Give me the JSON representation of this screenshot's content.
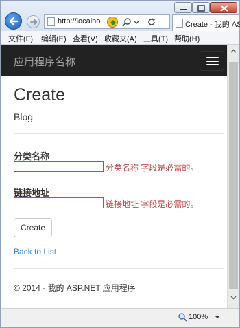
{
  "browser": {
    "address": "http://localho",
    "tab_title": "Create - 我的 ASP",
    "menu": [
      "文件(F)",
      "编辑(E)",
      "查看(V)",
      "收藏夹(A)",
      "工具(T)",
      "帮助(H)"
    ],
    "icons": {
      "back": "back-arrow-icon",
      "forward": "forward-arrow-icon",
      "minimize": "minimize-icon",
      "maximize": "maximize-icon",
      "close": "close-icon",
      "page": "page-icon",
      "compat": "compatibility-view-icon",
      "search": "search-icon",
      "refresh": "refresh-icon",
      "zoom": "zoom-icon"
    }
  },
  "page": {
    "brand": "应用程序名称",
    "heading": "Create",
    "subheading": "Blog",
    "fields": [
      {
        "label": "分类名称",
        "value": "",
        "error": "分类名称 字段是必需的。"
      },
      {
        "label": "链接地址",
        "value": "",
        "error": "链接地址 字段是必需的。"
      }
    ],
    "create_button": "Create",
    "back_link": "Back to List",
    "footer": "© 2014 - 我的 ASP.NET 应用程序"
  },
  "status": {
    "zoom": "100%"
  },
  "colors": {
    "navbar_bg": "#222222",
    "brand_text": "#9d9d9d",
    "error": "#b94a48",
    "link": "#428bca",
    "text": "#333333"
  }
}
